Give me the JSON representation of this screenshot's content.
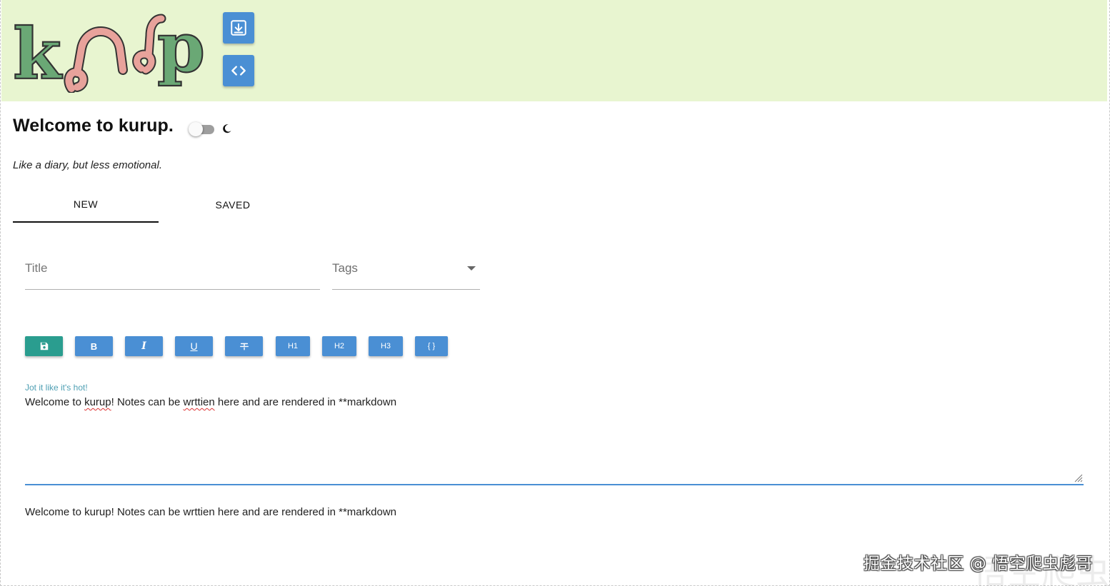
{
  "header": {
    "logo_text": "kurup",
    "brand_colors": {
      "green": "#6aa875",
      "pink": "#e8a29b",
      "outline": "#333333",
      "header_bg": "#e8f5d0"
    },
    "download_button_icon": "download-icon",
    "code_button_icon": "code-icon"
  },
  "intro": {
    "title": "Welcome to kurup.",
    "dark_mode_icon": "moon-icon",
    "dark_mode_on": false,
    "tagline": "Like a diary, but less emotional."
  },
  "tabs": [
    {
      "label": "NEW",
      "active": true
    },
    {
      "label": "SAVED",
      "active": false
    }
  ],
  "form": {
    "title_placeholder": "Title",
    "tags_label": "Tags"
  },
  "toolbar": {
    "save_icon": "floppy-disk-icon",
    "bold": "B",
    "italic": "I",
    "underline": "U",
    "strikethrough_icon": "strikethrough-icon",
    "h1": "H1",
    "h2": "H2",
    "h3": "H3",
    "code": "{ }"
  },
  "editor": {
    "label": "Jot it like it's hot!",
    "text_before": "Welcome to ",
    "word_kurup": "kurup",
    "text_mid": "! Notes can be ",
    "word_wrttien": "wrttien",
    "text_after": " here and are rendered in **markdown"
  },
  "preview": {
    "text": "Welcome to kurup! Notes can be wrttien here and are rendered in **markdown"
  },
  "watermark": {
    "text": "掘金技术社区 @ 悟空爬虫彪哥",
    "background_text": "悟空爬虫"
  }
}
